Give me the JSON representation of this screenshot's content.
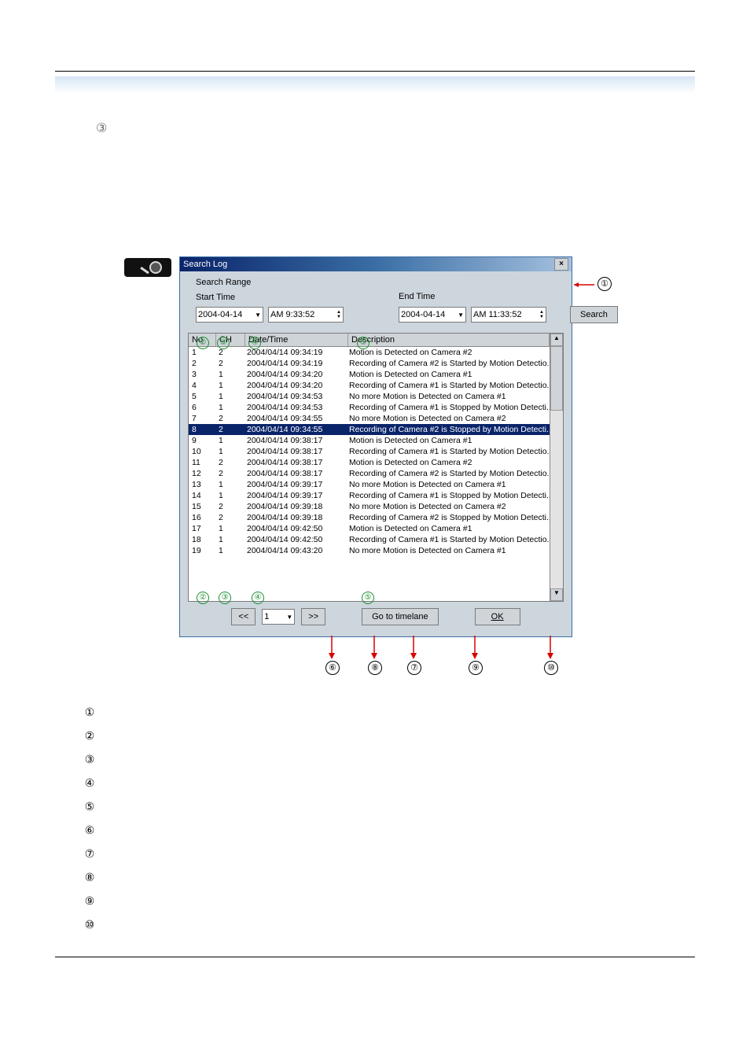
{
  "top_marker": "③",
  "window": {
    "title": "Search Log",
    "close": "×",
    "group_title": "Search Range",
    "start_label": "Start Time",
    "end_label": "End Time",
    "start_date": "2004-04-14",
    "start_time": "AM  9:33:52",
    "end_date": "2004-04-14",
    "end_time": "AM 11:33:52",
    "search_btn": "Search",
    "headers": {
      "no": "No",
      "ch": "CH",
      "dt": "Date/Time",
      "desc": "Description"
    },
    "rows": [
      {
        "no": "1",
        "ch": "2",
        "dt": "2004/04/14 09:34:19",
        "desc": "Motion is Detected on Camera #2"
      },
      {
        "no": "2",
        "ch": "2",
        "dt": "2004/04/14 09:34:19",
        "desc": "Recording of Camera #2 is Started by Motion Detectio..."
      },
      {
        "no": "3",
        "ch": "1",
        "dt": "2004/04/14 09:34:20",
        "desc": "Motion is Detected on Camera #1"
      },
      {
        "no": "4",
        "ch": "1",
        "dt": "2004/04/14 09:34:20",
        "desc": "Recording of Camera #1 is Started by Motion Detectio..."
      },
      {
        "no": "5",
        "ch": "1",
        "dt": "2004/04/14 09:34:53",
        "desc": "No more Motion is Detected on Camera #1"
      },
      {
        "no": "6",
        "ch": "1",
        "dt": "2004/04/14 09:34:53",
        "desc": "Recording of Camera #1 is Stopped by Motion Detecti..."
      },
      {
        "no": "7",
        "ch": "2",
        "dt": "2004/04/14 09:34:55",
        "desc": "No more Motion is Detected on Camera #2"
      },
      {
        "no": "8",
        "ch": "2",
        "dt": "2004/04/14 09:34:55",
        "desc": "Recording of Camera #2 is Stopped by Motion Detecti...",
        "sel": true
      },
      {
        "no": "9",
        "ch": "1",
        "dt": "2004/04/14 09:38:17",
        "desc": "Motion is Detected on Camera #1"
      },
      {
        "no": "10",
        "ch": "1",
        "dt": "2004/04/14 09:38:17",
        "desc": "Recording of Camera #1 is Started by Motion Detectio..."
      },
      {
        "no": "11",
        "ch": "2",
        "dt": "2004/04/14 09:38:17",
        "desc": "Motion is Detected on Camera #2"
      },
      {
        "no": "12",
        "ch": "2",
        "dt": "2004/04/14 09:38:17",
        "desc": "Recording of Camera #2 is Started by Motion Detectio..."
      },
      {
        "no": "13",
        "ch": "1",
        "dt": "2004/04/14 09:39:17",
        "desc": "No more Motion is Detected on Camera #1"
      },
      {
        "no": "14",
        "ch": "1",
        "dt": "2004/04/14 09:39:17",
        "desc": "Recording of Camera #1 is Stopped by Motion Detecti..."
      },
      {
        "no": "15",
        "ch": "2",
        "dt": "2004/04/14 09:39:18",
        "desc": "No more Motion is Detected on Camera #2"
      },
      {
        "no": "16",
        "ch": "2",
        "dt": "2004/04/14 09:39:18",
        "desc": "Recording of Camera #2 is Stopped by Motion Detecti..."
      },
      {
        "no": "17",
        "ch": "1",
        "dt": "2004/04/14 09:42:50",
        "desc": "Motion is Detected on Camera #1"
      },
      {
        "no": "18",
        "ch": "1",
        "dt": "2004/04/14 09:42:50",
        "desc": "Recording of Camera #1 is Started by Motion Detectio..."
      },
      {
        "no": "19",
        "ch": "1",
        "dt": "2004/04/14 09:43:20",
        "desc": "No more Motion is Detected on Camera #1"
      }
    ],
    "prev": "<<",
    "page": "1",
    "next": ">>",
    "goto": "Go to timelane",
    "ok": "OK"
  },
  "callouts": {
    "c1": "①",
    "c2": "②",
    "c3": "③",
    "c4": "④",
    "c5": "⑤",
    "c6": "⑥",
    "c7": "⑦",
    "c8": "⑧",
    "c9": "⑨",
    "c10": "⑩"
  },
  "legend": [
    "①",
    "②",
    "③",
    "④",
    "⑤",
    "⑥",
    "⑦",
    "⑧",
    "⑨",
    "⑩"
  ]
}
